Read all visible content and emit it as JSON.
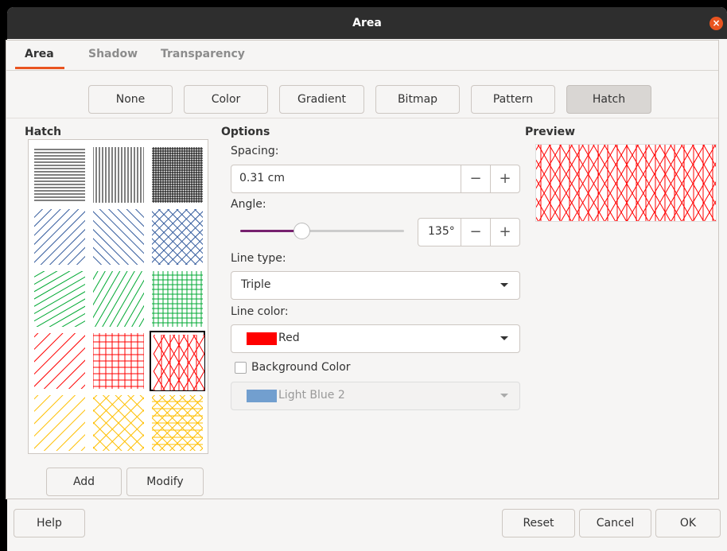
{
  "window": {
    "title": "Area",
    "close_icon": "×"
  },
  "tabs": [
    {
      "label": "Area",
      "active": true
    },
    {
      "label": "Shadow",
      "active": false
    },
    {
      "label": "Transparency",
      "active": false
    }
  ],
  "fill_buttons": {
    "none": "None",
    "color": "Color",
    "gradient": "Gradient",
    "bitmap": "Bitmap",
    "pattern": "Pattern",
    "hatch": "Hatch",
    "selected": "Hatch"
  },
  "hatch": {
    "heading": "Hatch",
    "add": "Add",
    "modify": "Modify",
    "selected_index": 11,
    "items": [
      {
        "color": "#000000",
        "angles": [
          0
        ],
        "spacing": 4
      },
      {
        "color": "#000000",
        "angles": [
          90
        ],
        "spacing": 4
      },
      {
        "color": "#000000",
        "angles": [
          0,
          90
        ],
        "spacing": 3
      },
      {
        "color": "#355d9e",
        "angles": [
          45
        ],
        "spacing": 8
      },
      {
        "color": "#355d9e",
        "angles": [
          135
        ],
        "spacing": 8
      },
      {
        "color": "#355d9e",
        "angles": [
          45,
          135
        ],
        "spacing": 8
      },
      {
        "color": "#00a933",
        "angles": [
          30
        ],
        "spacing": 8
      },
      {
        "color": "#00a933",
        "angles": [
          60
        ],
        "spacing": 8
      },
      {
        "color": "#00a933",
        "angles": [
          0,
          90
        ],
        "spacing": 6
      },
      {
        "color": "#ff0000",
        "angles": [
          45
        ],
        "spacing": 11
      },
      {
        "color": "#ff0000",
        "angles": [
          0,
          90
        ],
        "spacing": 8
      },
      {
        "color": "#ff0000",
        "angles": [
          90,
          60,
          120
        ],
        "spacing": 11
      },
      {
        "color": "#ffbf00",
        "angles": [
          45
        ],
        "spacing": 11
      },
      {
        "color": "#ffbf00",
        "angles": [
          45,
          135
        ],
        "spacing": 11
      },
      {
        "color": "#ffbf00",
        "angles": [
          0,
          45,
          135
        ],
        "spacing": 9
      }
    ]
  },
  "options": {
    "heading": "Options",
    "spacing_label": "Spacing:",
    "spacing_value": "0.31 cm",
    "angle_label": "Angle:",
    "angle_value": "135°",
    "angle_slider_fraction": 0.375,
    "minus": "−",
    "plus": "+",
    "line_type_label": "Line type:",
    "line_type_value": "Triple",
    "line_color_label": "Line color:",
    "line_color_value": "Red",
    "line_color_swatch": "#ff0000",
    "background_color_label": "Background Color",
    "background_color_checked": false,
    "background_color_value": "Light Blue 2",
    "background_color_swatch": "#729fcf"
  },
  "preview": {
    "heading": "Preview",
    "color": "#ff0000"
  },
  "footer": {
    "help": "Help",
    "reset": "Reset",
    "cancel": "Cancel",
    "ok": "OK"
  },
  "colors": {
    "accent": "#e95420",
    "slider": "#77216f"
  }
}
